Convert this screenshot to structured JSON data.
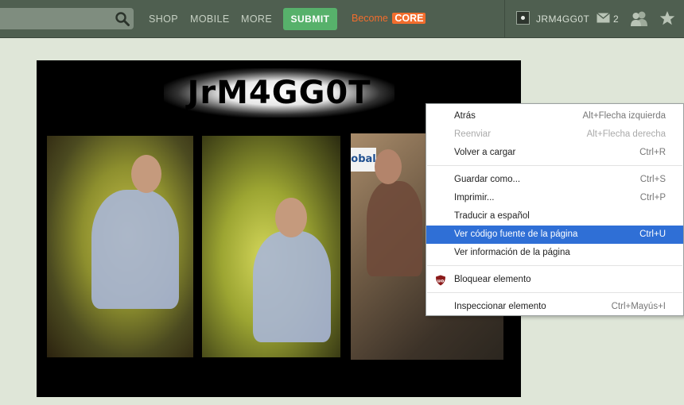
{
  "topbar": {
    "search": {
      "value": "",
      "placeholder": ""
    },
    "nav": [
      "SHOP",
      "MOBILE",
      "MORE"
    ],
    "submit_label": "SUBMIT",
    "become_label": "Become",
    "core_label": "CORE",
    "username": "JRM4GG0T",
    "message_count": "2",
    "accent_color": "#57b16b",
    "become_color": "#f26d2d"
  },
  "banner": {
    "title": "JrM4GG0T",
    "sign_text": "obal"
  },
  "context_menu": {
    "items": [
      {
        "label": "Atrás",
        "shortcut": "Alt+Flecha izquierda"
      },
      {
        "label": "Reenviar",
        "shortcut": "Alt+Flecha derecha",
        "disabled": true
      },
      {
        "label": "Volver a cargar",
        "shortcut": "Ctrl+R"
      },
      {
        "label": "Guardar como...",
        "shortcut": "Ctrl+S"
      },
      {
        "label": "Imprimir...",
        "shortcut": "Ctrl+P"
      },
      {
        "label": "Traducir a español",
        "shortcut": ""
      },
      {
        "label": "Ver código fuente de la página",
        "shortcut": "Ctrl+U",
        "highlighted": true
      },
      {
        "label": "Ver información de la página",
        "shortcut": ""
      },
      {
        "label": "Bloquear elemento",
        "shortcut": "",
        "icon": "ublock-icon"
      },
      {
        "label": "Inspeccionar elemento",
        "shortcut": "Ctrl+Mayús+I"
      }
    ],
    "highlight_color": "#2f6fd6"
  }
}
